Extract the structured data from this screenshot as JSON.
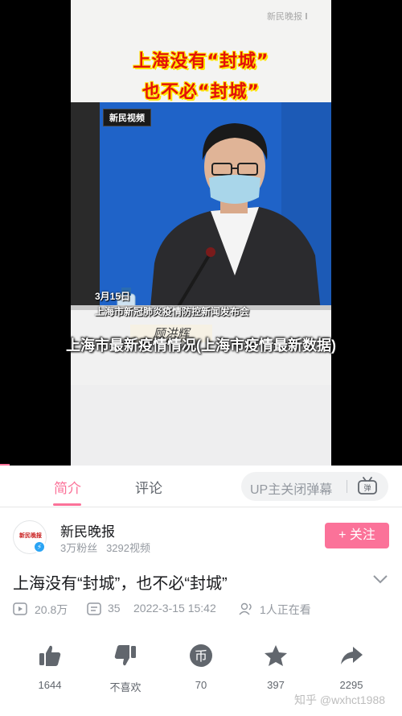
{
  "player": {
    "frame_watermark": "新民晚报",
    "banner_line1": "上海没有“封城”",
    "banner_line2": "也不必“封城”",
    "logo_badge": "新民视频",
    "caption_date": "3月15日",
    "caption_event": "上海市新冠肺炎疫情防控新闻发布会",
    "nameplate": "顾洪辉",
    "overlay_title": "上海市最新疫情情况(上海市疫情最新数据)"
  },
  "tabs": {
    "intro": "简介",
    "comments": "评论",
    "danmaku_toggle": "UP主关闭弹幕"
  },
  "uploader": {
    "avatar_text": "新民晚报",
    "name": "新民晚报",
    "fans": "3万粉丝",
    "videos": "3292视频",
    "follow_label": "+ 关注"
  },
  "video": {
    "title": "上海没有“封城”，也不必“封城”",
    "views": "20.8万",
    "danmaku_count": "35",
    "date": "2022-3-15 15:42",
    "watching": "1人正在看"
  },
  "actions": {
    "like_count": "1644",
    "dislike_label": "不喜欢",
    "coin_count": "70",
    "favorite_count": "397",
    "share_count": "2295"
  },
  "watermark": "知乎 @wxhct1988",
  "colors": {
    "accent_pink": "#fb7299",
    "text_grey": "#9499a0",
    "banner_red": "#e3120b",
    "banner_yellow": "#ffe600"
  },
  "icons": [
    "play-count-icon",
    "danmaku-count-icon",
    "watching-icon",
    "like-icon",
    "dislike-icon",
    "coin-icon",
    "star-icon",
    "share-icon",
    "danmaku-settings-icon",
    "chevron-down-icon",
    "verified-icon"
  ]
}
